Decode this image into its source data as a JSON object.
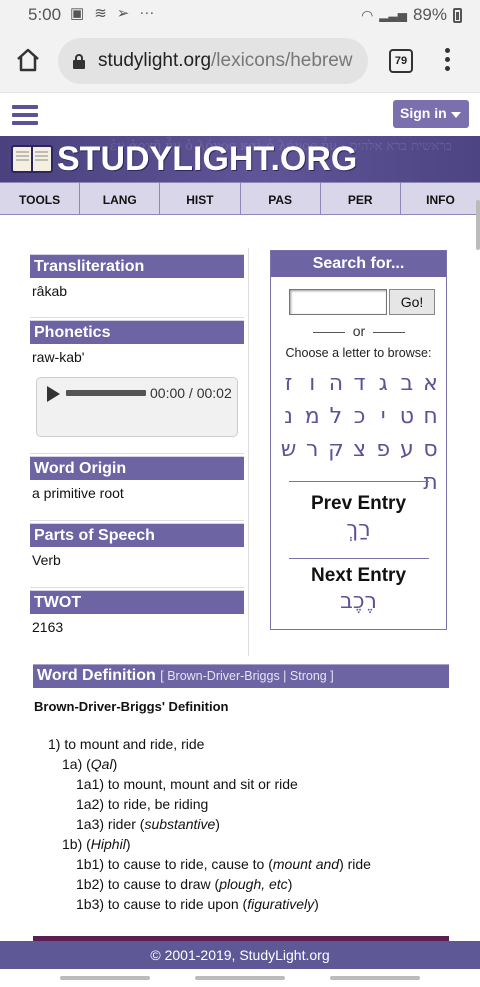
{
  "status_bar": {
    "time": "5:00",
    "battery": "89%",
    "icons": [
      "image-icon",
      "wifi-call-icon",
      "send-icon",
      "more-icon"
    ]
  },
  "browser": {
    "url_domain": "studylight.org",
    "url_path": "/lexicons/hebrew",
    "tab_count": "79"
  },
  "site": {
    "signin_label": "Sign in",
    "logo": "STUDYLIGHT.ORG",
    "nav": [
      "TOOLS",
      "LANG",
      "HIST",
      "PAS",
      "PER",
      "INFO"
    ],
    "hebrew_fragment": "ְ ַ"
  },
  "lexicon": {
    "transliteration_label": "Transliteration",
    "transliteration": "râkab",
    "phonetics_label": "Phonetics",
    "phonetics": "raw-kab'",
    "audio_time": "00:00 / 00:02",
    "origin_label": "Word Origin",
    "origin": "a primitive root",
    "pos_label": "Parts of Speech",
    "pos": "Verb",
    "twot_label": "TWOT",
    "twot": "2163"
  },
  "search": {
    "title": "Search for...",
    "input_value": "",
    "go_label": "Go!",
    "or_label": "or",
    "choose_label": "Choose a letter to browse:",
    "letters": [
      "א",
      "ב",
      "ג",
      "ד",
      "ה",
      "ו",
      "ז",
      "ח",
      "ט",
      "י",
      "כ",
      "ל",
      "מ",
      "נ",
      "ס",
      "ע",
      "פ",
      "צ",
      "ק",
      "ר",
      "ש",
      "ת"
    ],
    "prev_label": "Prev Entry",
    "prev_word": "רַךְ",
    "next_label": "Next Entry",
    "next_word": "רֶכֶב"
  },
  "definition": {
    "title": "Word Definition",
    "sources": "[ Brown-Driver-Briggs | Strong ]",
    "subtitle": "Brown-Driver-Briggs' Definition",
    "lines": [
      "1) to mount and ride, ride",
      "1a) (Qal)",
      "1a1) to mount, mount and sit or ride",
      "1a2) to ride, be riding",
      "1a3) rider (substantive)",
      "1b) (Hiphil)",
      "1b1) to cause to ride, cause to (mount and) ride",
      "1b2) to cause to draw (plough, etc)",
      "1b3) to cause to ride upon (figuratively)"
    ]
  },
  "footer": "© 2001-2019, StudyLight.org"
}
